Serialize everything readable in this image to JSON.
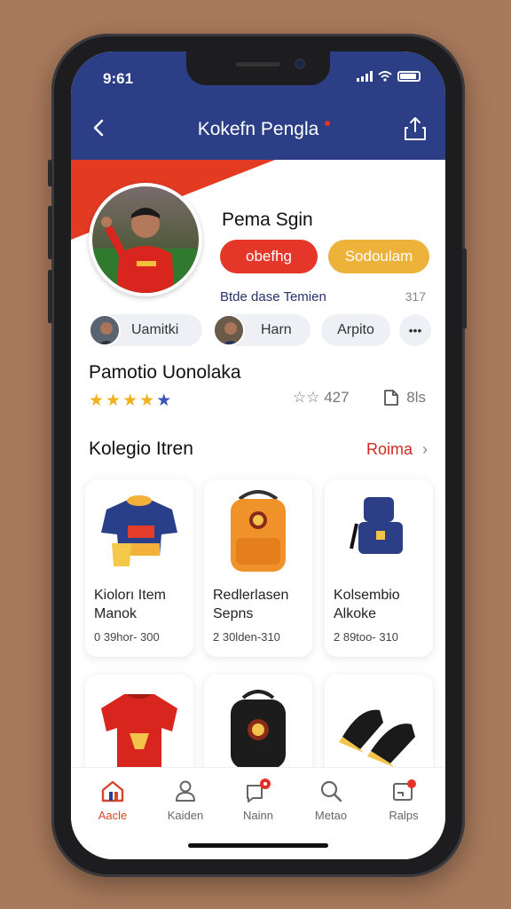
{
  "status_bar": {
    "time": "9:61"
  },
  "header": {
    "title": "Kokefn Pengla"
  },
  "profile": {
    "name": "Pema Sgin",
    "primary_button": "obefhg",
    "secondary_button": "Sodoulam",
    "subtitle": "Btde  dase Temien",
    "subtitle_count": "317"
  },
  "chips": [
    {
      "label": "Uamitki"
    },
    {
      "label": "Harn"
    },
    {
      "label": "Arpito"
    },
    {
      "label": "•••"
    }
  ],
  "rating_section": {
    "title": "Pamotio Uonolaka",
    "stars_filled": 4,
    "stars_total": 5,
    "right_text": "☆☆ 427",
    "doc_count": "8ls"
  },
  "collection": {
    "title": "Kolegio Itren",
    "link": "Roima",
    "items": [
      {
        "name": "Kiolorı Item Manok",
        "meta": "0   39hor- 300"
      },
      {
        "name": "Redlerlasen Sepns",
        "meta": "2   30lden-310"
      },
      {
        "name": "Kolsembio Alkoke",
        "meta": "2   89too- 310"
      }
    ]
  },
  "tabbar": {
    "items": [
      {
        "label": "Aacle",
        "icon": "home-icon",
        "active": true
      },
      {
        "label": "Kaiden",
        "icon": "user-icon",
        "active": false
      },
      {
        "label": "Nainn",
        "icon": "chat-icon",
        "active": false
      },
      {
        "label": "Metao",
        "icon": "search-icon",
        "active": false
      },
      {
        "label": "Ralps",
        "icon": "cart-icon",
        "active": false
      }
    ]
  },
  "colors": {
    "header_bg": "#2c3f86",
    "accent_red": "#e4372a",
    "accent_yellow": "#edb23a",
    "star": "#f2b21b"
  }
}
